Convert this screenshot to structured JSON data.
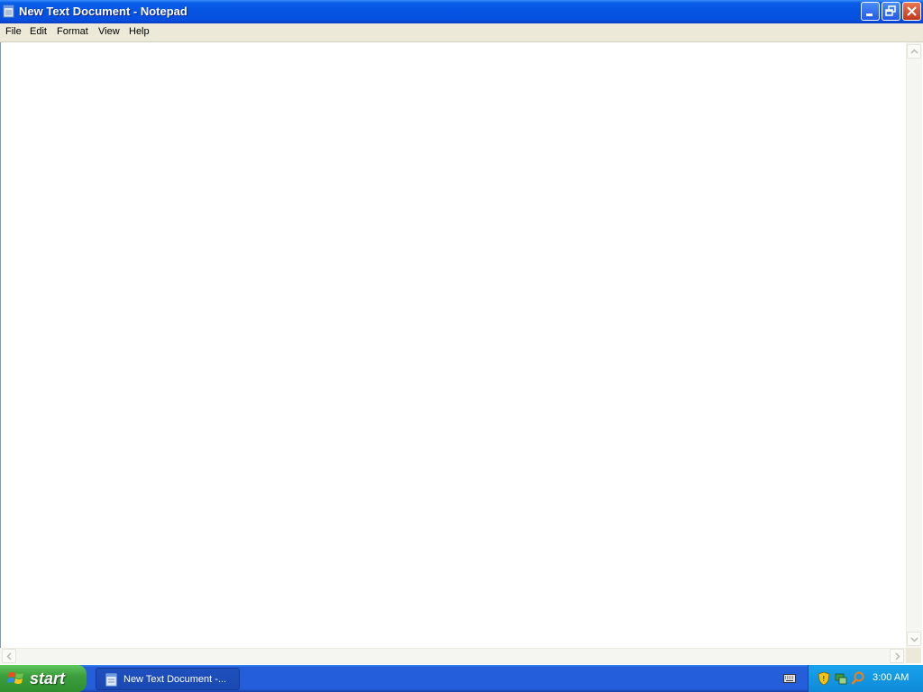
{
  "window": {
    "title": "New Text Document - Notepad"
  },
  "menu": [
    "File",
    "Edit",
    "Format",
    "View",
    "Help"
  ],
  "editor": {
    "content": ""
  },
  "taskbar": {
    "start_label": "start",
    "task_button_label": "New Text Document -...",
    "clock": "3:00 AM"
  },
  "colors": {
    "titlebar": "#0553e2",
    "menubar": "#ece9d8",
    "taskbar": "#245edb",
    "start": "#3c9e3c",
    "tray": "#0f90db"
  },
  "icons": [
    "notepad-icon",
    "minimize-icon",
    "restore-icon",
    "close-icon",
    "windows-logo-icon",
    "keyboard-icon",
    "security-shield-icon",
    "network-icon",
    "search-icon"
  ]
}
